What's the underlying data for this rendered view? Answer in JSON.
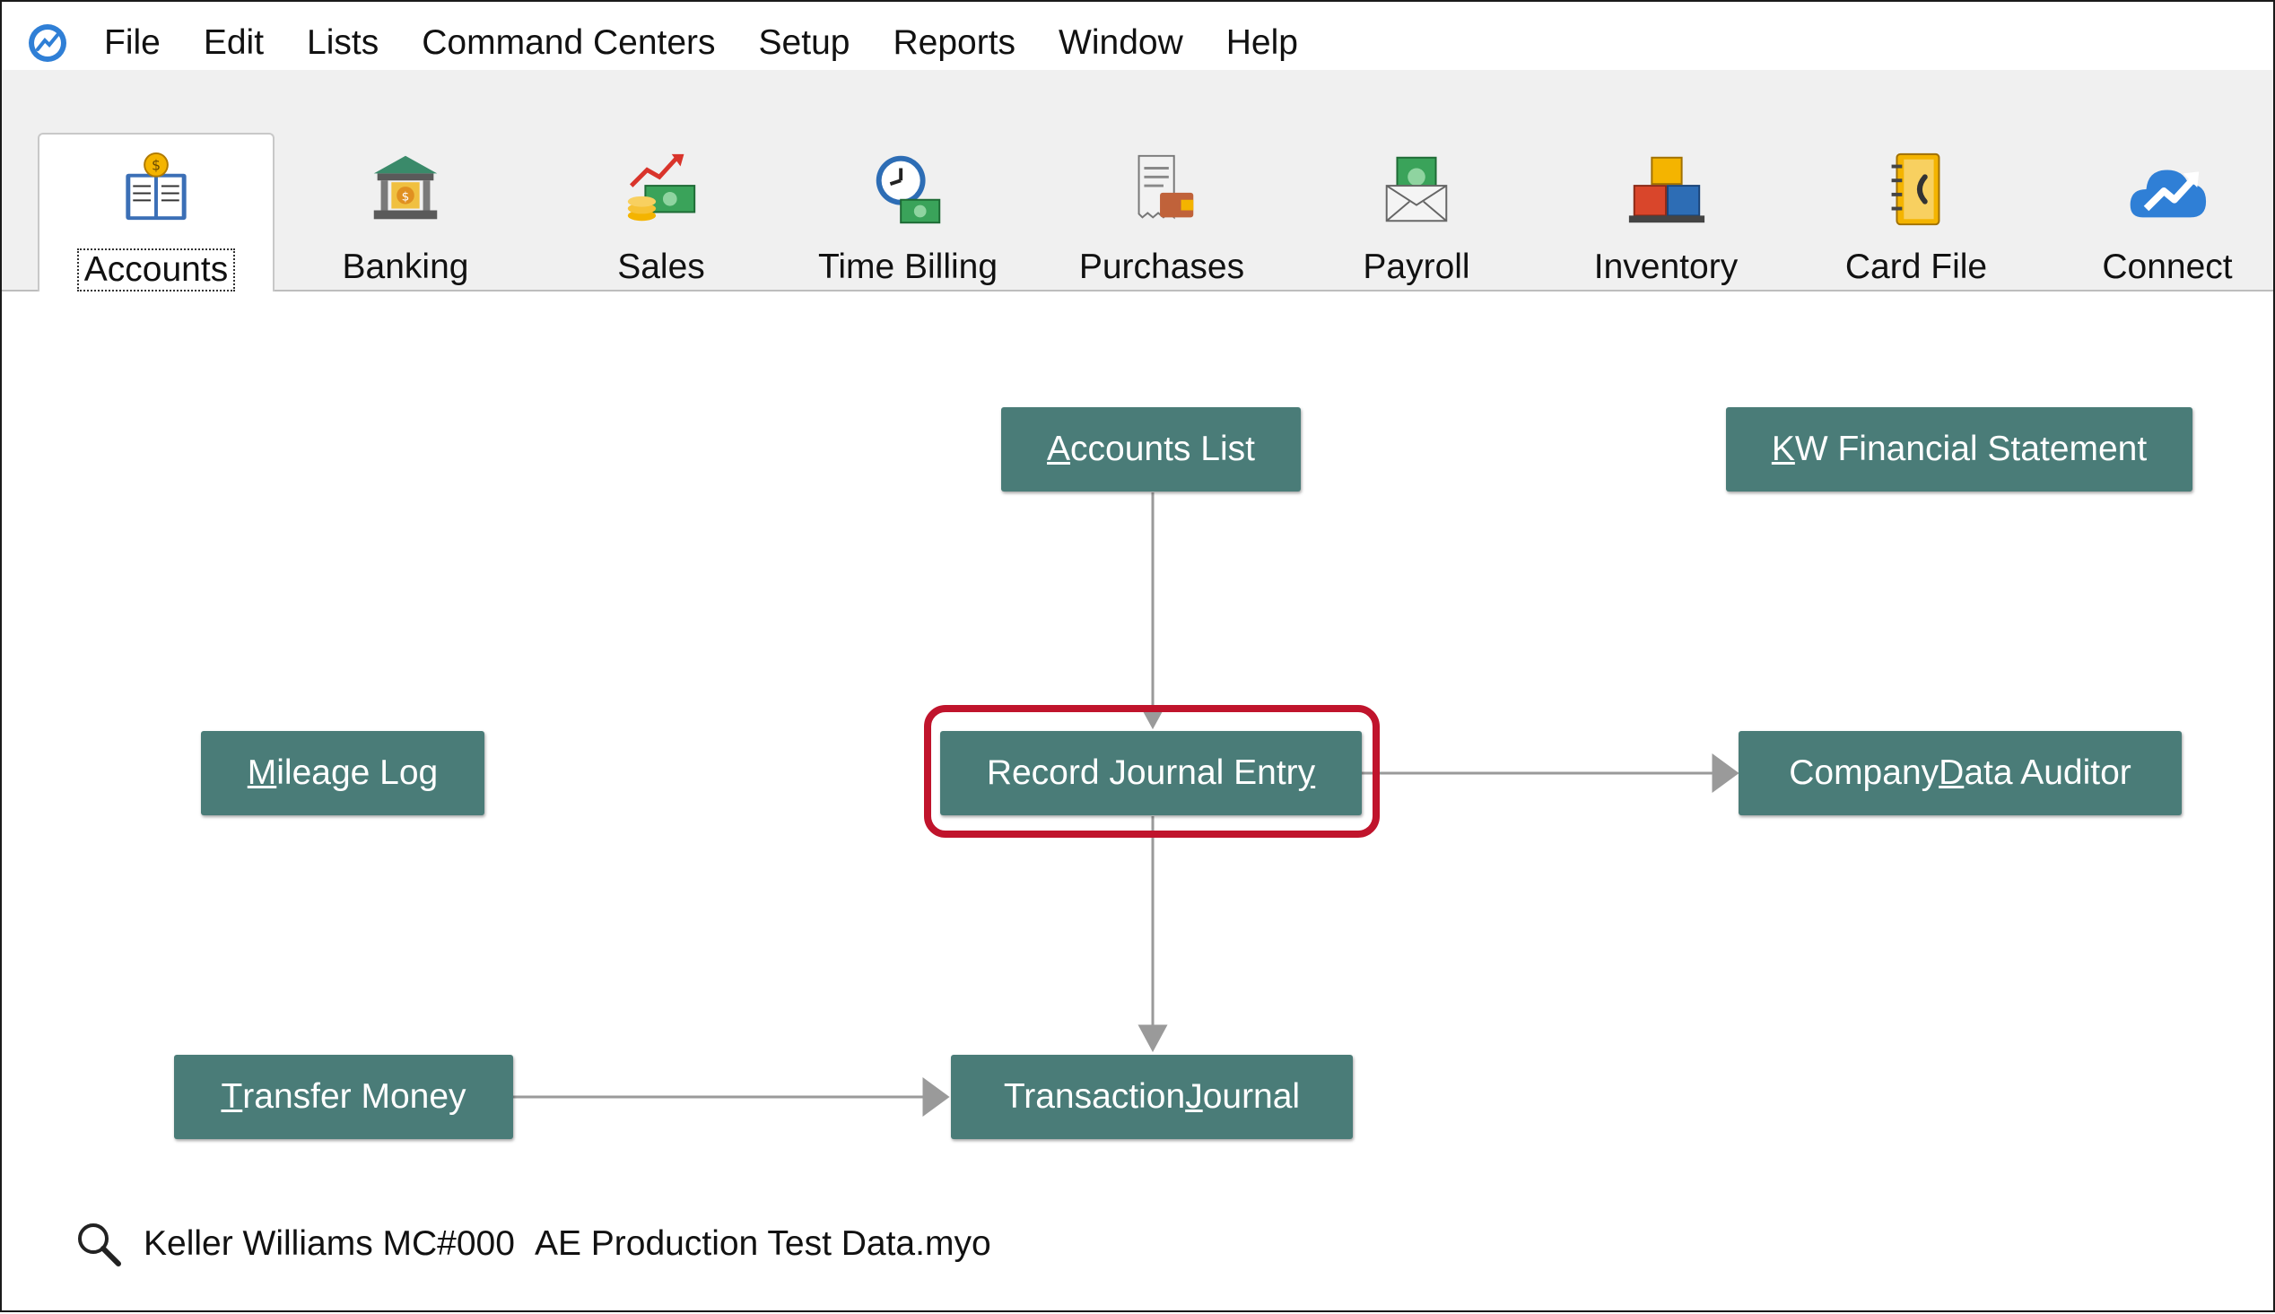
{
  "menu": {
    "items": [
      "File",
      "Edit",
      "Lists",
      "Command Centers",
      "Setup",
      "Reports",
      "Window",
      "Help"
    ]
  },
  "command_centers": [
    {
      "label": "Accounts",
      "icon": "accounts-ledger-icon",
      "active": true
    },
    {
      "label": "Banking",
      "icon": "bank-building-icon",
      "active": false
    },
    {
      "label": "Sales",
      "icon": "sales-money-chart-icon",
      "active": false
    },
    {
      "label": "Time Billing",
      "icon": "clock-money-icon",
      "active": false
    },
    {
      "label": "Purchases",
      "icon": "receipt-wallet-icon",
      "active": false
    },
    {
      "label": "Payroll",
      "icon": "envelope-cash-icon",
      "active": false
    },
    {
      "label": "Inventory",
      "icon": "boxes-icon",
      "active": false
    },
    {
      "label": "Card File",
      "icon": "address-book-icon",
      "active": false
    },
    {
      "label": "Connect",
      "icon": "cloud-arrow-icon",
      "active": false
    }
  ],
  "flow": {
    "accounts_list": {
      "pre": "",
      "u": "A",
      "post": "ccounts List"
    },
    "kw_financial": {
      "pre": "",
      "u": "K",
      "post": "W Financial Statement"
    },
    "mileage_log": {
      "pre": "",
      "u": "M",
      "post": "ileage Log"
    },
    "record_journal": {
      "pre": "Record Journal Entr",
      "u": "y",
      "post": ""
    },
    "company_auditor": {
      "pre": "Company ",
      "u": "D",
      "post": "ata Auditor"
    },
    "transfer_money": {
      "pre": "",
      "u": "T",
      "post": "ransfer Money"
    },
    "transaction_journal": {
      "pre": "Transaction ",
      "u": "J",
      "post": "ournal"
    }
  },
  "colors": {
    "button": "#4a7c78",
    "highlight": "#c0142c",
    "connector": "#9a9a9a"
  },
  "status": {
    "company": "Keller Williams MC#000",
    "file": "AE Production Test Data.myo"
  }
}
